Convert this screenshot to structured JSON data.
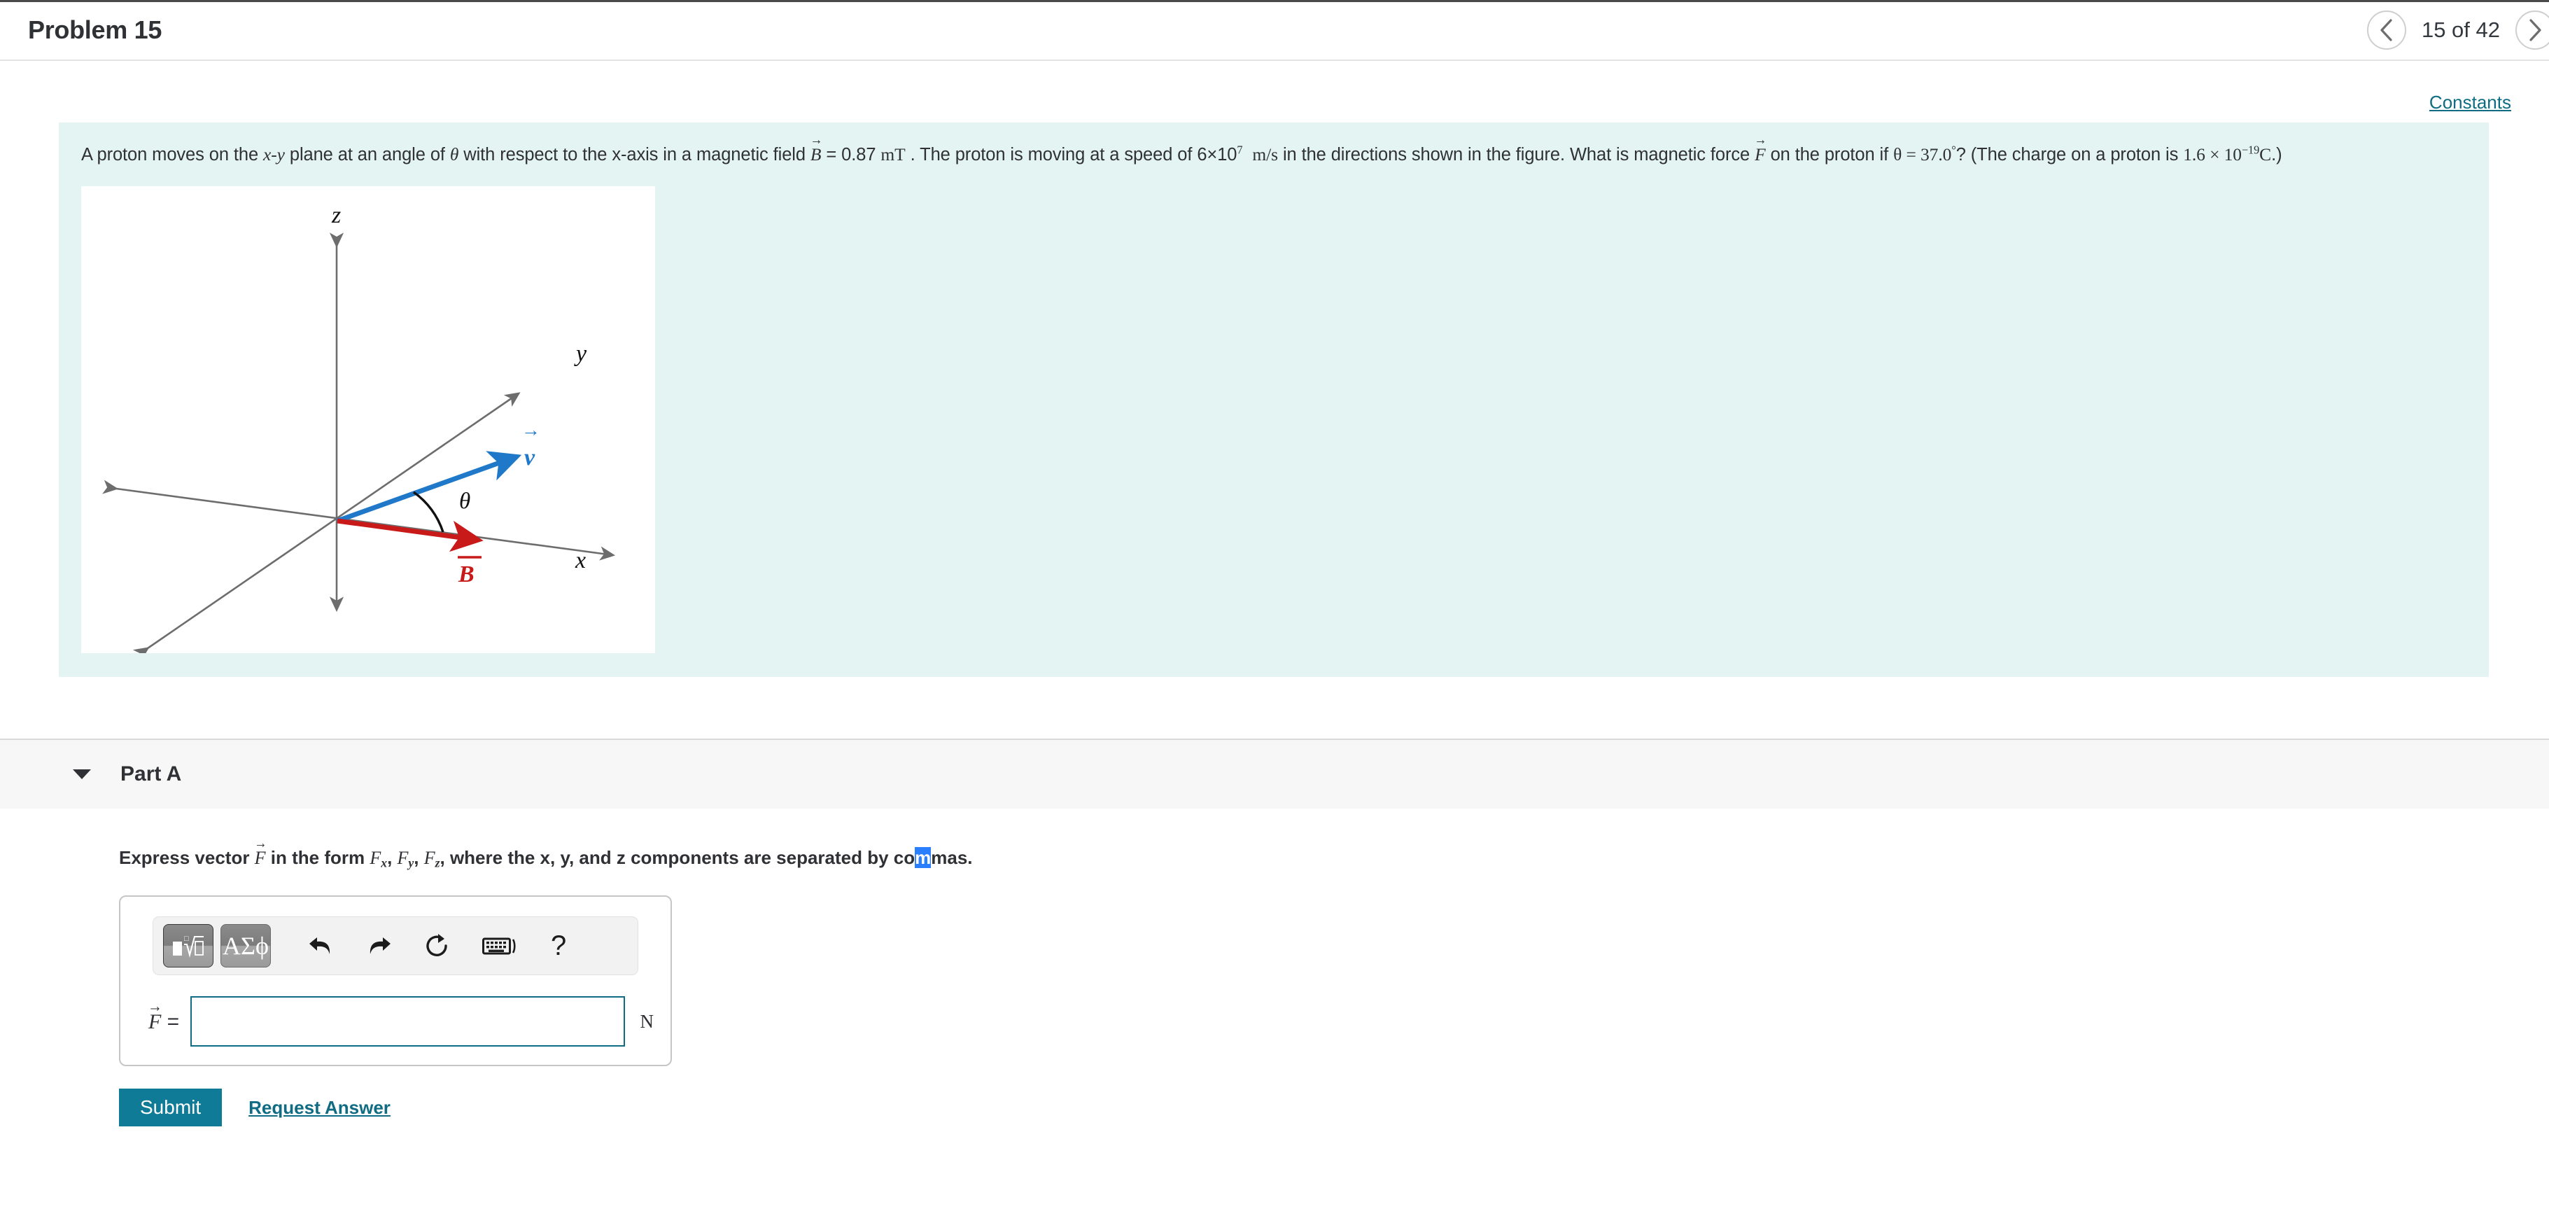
{
  "header": {
    "problem_title": "Problem 15",
    "prev_icon": "chevron-left-icon",
    "next_icon": "chevron-right-icon",
    "counter": "15 of 42"
  },
  "constants": {
    "label": "Constants"
  },
  "problem": {
    "seg1": "A proton moves on the ",
    "xy": "x-y",
    "seg2": " plane at an angle of ",
    "theta": "θ",
    "seg3": " with respect to the x-axis in a magnetic field ",
    "B_vec": "B",
    "seg4": " = 0.87 ",
    "unit_mT": "mT",
    "seg5": " . The proton is moving at a speed of 6×10",
    "exp7": "7",
    "unit_ms": "m/s",
    "seg6": " in the directions shown in the figure. What is magnetic force ",
    "F_vec": "F",
    "seg7": " on the proton if ",
    "theta_eq": "θ = 37.0",
    "deg": "°",
    "seg8": "? (The charge on a proton is ",
    "charge": "1.6 × 10",
    "charge_exp": "−19",
    "charge_unit": "C",
    "seg9": ".)"
  },
  "figure": {
    "axis_z": "z",
    "axis_y": "y",
    "axis_x": "x",
    "label_v": "v",
    "label_B": "B",
    "label_theta": "θ",
    "color_v": "#1f78c8",
    "color_B": "#c91a1a",
    "color_axis": "#6d6d6d"
  },
  "partA": {
    "caret_icon": "caret-down-icon",
    "title": "Part A",
    "prompt_pre": "Express vector ",
    "prompt_F": "F",
    "prompt_mid": " in the form ",
    "comp_x": "F",
    "comp_x_sub": "x",
    "comp_y": "F",
    "comp_y_sub": "y",
    "comp_z": "F",
    "comp_z_sub": "z",
    "prompt_tail_a": ", where the x, y, and z components are separated by co",
    "prompt_selected": "m",
    "prompt_tail_b": "mas."
  },
  "answer": {
    "toolbar": {
      "template_button": "template-math-icon",
      "greek_button": "ΑΣϕ",
      "undo_icon": "↩",
      "redo_icon": "↪",
      "reset_icon": "↻",
      "keyboard_icon": "keyboard-icon",
      "help_icon": "?"
    },
    "field_label": "F",
    "field_equals": "=",
    "field_value": "",
    "field_placeholder": "",
    "unit": "N"
  },
  "actions": {
    "submit_label": "Submit",
    "request_answer_label": "Request Answer"
  },
  "colors": {
    "panel_bg": "#e4f4f2",
    "accent": "#0f7b96",
    "link": "#0f6c82",
    "selection": "#2a7fff"
  }
}
